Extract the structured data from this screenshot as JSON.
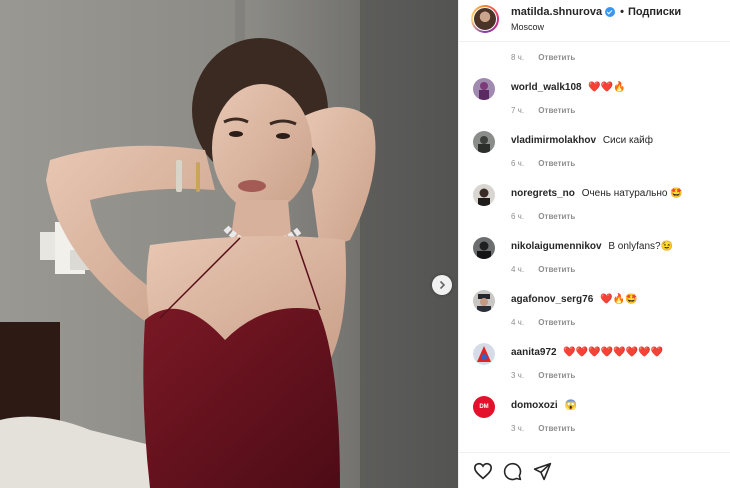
{
  "post": {
    "username": "matilda.shnurova",
    "follow_label": "Подписки",
    "separator": "•",
    "location": "Moscow"
  },
  "first_comment_meta": {
    "time": "8 ч.",
    "reply": "Ответить"
  },
  "comments": [
    {
      "username": "world_walk108",
      "text": "❤️❤️🔥",
      "time": "7 ч.",
      "reply": "Ответить"
    },
    {
      "username": "vladimirmolakhov",
      "text": "Сиси кайф",
      "time": "6 ч.",
      "reply": "Ответить"
    },
    {
      "username": "noregrets_no",
      "text": "Очень натурально 🤩",
      "time": "6 ч.",
      "reply": "Ответить"
    },
    {
      "username": "nikolaigumennikov",
      "text": "В onlyfans?😉",
      "time": "4 ч.",
      "reply": "Ответить"
    },
    {
      "username": "agafonov_serg76",
      "text": "❤️🔥🤩",
      "time": "4 ч.",
      "reply": "Ответить"
    },
    {
      "username": "aanita972",
      "text": "❤️❤️❤️❤️❤️❤️❤️❤️",
      "time": "3 ч.",
      "reply": "Ответить"
    },
    {
      "username": "domoxozi",
      "text": "😱",
      "time": "3 ч.",
      "reply": "Ответить"
    }
  ],
  "avatar_badge": "DM",
  "icons": {
    "like": "heart-icon",
    "comment": "comment-icon",
    "share": "share-icon",
    "next": "chevron-right-icon",
    "verified": "verified-badge-icon"
  },
  "colors": {
    "verified_blue": "#3897f0",
    "meta_gray": "#8e8e8e",
    "text": "#262626",
    "dress": "#6b1420"
  }
}
